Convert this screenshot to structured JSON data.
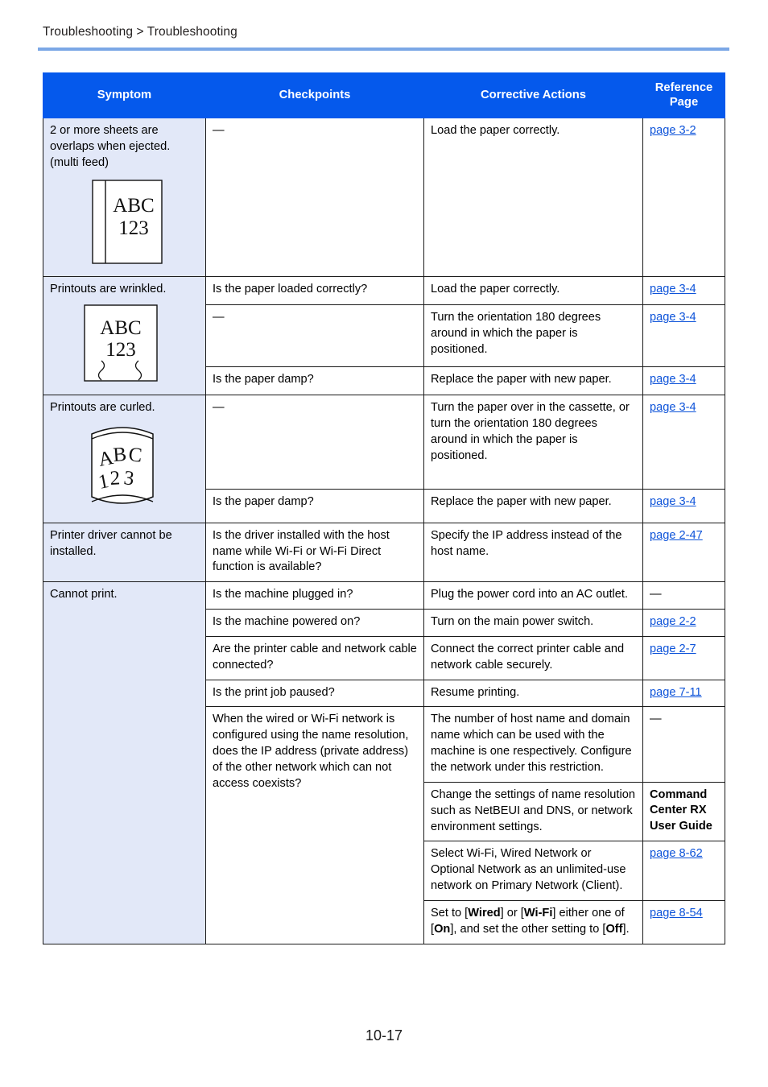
{
  "header": {
    "breadcrumb": "Troubleshooting > Troubleshooting"
  },
  "table": {
    "columns": [
      "Symptom",
      "Checkpoints",
      "Corrective Actions",
      "Reference Page"
    ],
    "headers": {
      "symptom": "Symptom",
      "checkpoints": "Checkpoints",
      "corrective_actions": "Corrective Actions",
      "reference_page": "Reference Page"
    },
    "rows": [
      {
        "symptom": "2 or more sheets are overlaps when ejected. (multi feed)",
        "illustration": "multi-feed-paper-diagram",
        "illustration_text": [
          "ABC",
          "123"
        ],
        "entries": [
          {
            "checkpoint": "—",
            "action": "Load the paper correctly.",
            "reference": "page 3-2",
            "reference_link": true
          }
        ]
      },
      {
        "symptom": "Printouts are wrinkled.",
        "illustration": "wrinkled-paper-diagram",
        "illustration_text": [
          "ABC",
          "123"
        ],
        "entries": [
          {
            "checkpoint": "Is the paper loaded correctly?",
            "action": "Load the paper correctly.",
            "reference": "page 3-4",
            "reference_link": true
          },
          {
            "checkpoint": "—",
            "action": "Turn the orientation 180 degrees around in which the paper is positioned.",
            "reference": "page 3-4",
            "reference_link": true
          },
          {
            "checkpoint": "Is the paper damp?",
            "action": "Replace the paper with new paper.",
            "reference": "page 3-4",
            "reference_link": true
          }
        ]
      },
      {
        "symptom": "Printouts are curled.",
        "illustration": "curled-paper-diagram",
        "illustration_text": [
          "ABC",
          "123"
        ],
        "entries": [
          {
            "checkpoint": "—",
            "action": "Turn the paper over in the cassette, or turn the orientation 180 degrees around in which the paper is positioned.",
            "reference": "page 3-4",
            "reference_link": true
          },
          {
            "checkpoint": "Is the paper damp?",
            "action": "Replace the paper with new paper.",
            "reference": "page 3-4",
            "reference_link": true
          }
        ]
      },
      {
        "symptom": "Printer driver cannot be installed.",
        "illustration": null,
        "entries": [
          {
            "checkpoint": "Is the driver installed with the host name while Wi-Fi or Wi-Fi Direct function is available?",
            "action": "Specify the IP address instead of the host name.",
            "reference": "page 2-47",
            "reference_link": true
          }
        ]
      },
      {
        "symptom": "Cannot print.",
        "illustration": null,
        "entries": [
          {
            "checkpoint": "Is the machine plugged in?",
            "action": "Plug the power cord into an AC outlet.",
            "reference": "—",
            "reference_link": false
          },
          {
            "checkpoint": "Is the machine powered on?",
            "action": "Turn on the main power switch.",
            "reference": "page 2-2",
            "reference_link": true
          },
          {
            "checkpoint": "Are the printer cable and network cable connected?",
            "action": "Connect the correct printer cable and network cable securely.",
            "reference": "page 2-7",
            "reference_link": true
          },
          {
            "checkpoint": "Is the print job paused?",
            "action": "Resume printing.",
            "reference": "page 7-11",
            "reference_link": true
          },
          {
            "checkpoint": "When the wired or Wi-Fi network is configured using the name resolution, does the IP address (private address) of the other network which can not access coexists?",
            "action": "The number of host name and domain name which can be used with the machine is one respectively. Configure the network under this restriction.",
            "reference": "—",
            "reference_link": false
          },
          {
            "checkpoint": "",
            "action": "Change the settings of name resolution such as NetBEUI and DNS, or network environment settings.",
            "reference": "Command Center RX User Guide",
            "reference_link": false,
            "reference_bold": true
          },
          {
            "checkpoint": "",
            "action": "Select Wi-Fi, Wired Network or Optional Network as an unlimited-use network on Primary Network (Client).",
            "reference": "page 8-62",
            "reference_link": true
          },
          {
            "checkpoint": "",
            "action_parts": [
              {
                "t": "Set to [",
                "b": false
              },
              {
                "t": "Wired",
                "b": true
              },
              {
                "t": "] or [",
                "b": false
              },
              {
                "t": "Wi-Fi",
                "b": true
              },
              {
                "t": "] either one of [",
                "b": false
              },
              {
                "t": "On",
                "b": true
              },
              {
                "t": "], and set the other setting to [",
                "b": false
              },
              {
                "t": "Off",
                "b": true
              },
              {
                "t": "].",
                "b": false
              }
            ],
            "action": "Set to [Wired] or [Wi-Fi] either one of [On], and set the other setting to [Off].",
            "reference": "page 8-54",
            "reference_link": true
          }
        ]
      }
    ]
  },
  "footer": {
    "page_number": "10-17"
  },
  "colors": {
    "header_blue": "#0559ec",
    "symptom_bg": "#e2e8f8",
    "rule_blue": "#7ba7e6",
    "link_blue": "#0d53d9"
  }
}
